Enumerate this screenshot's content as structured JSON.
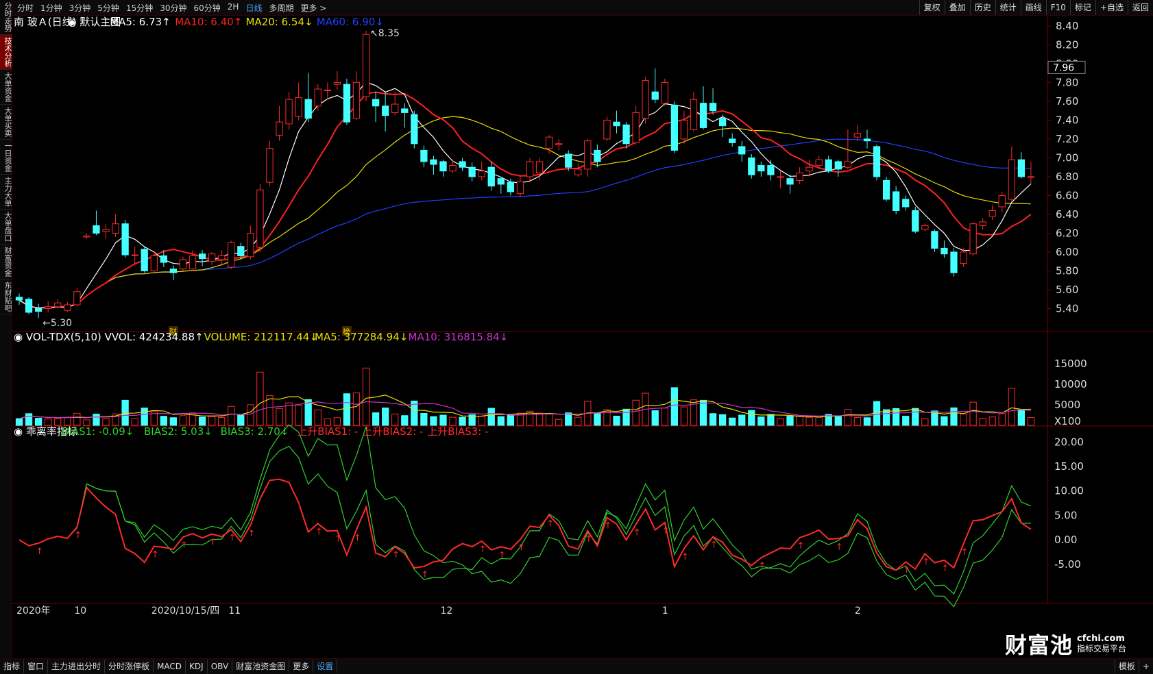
{
  "periods": [
    "分时",
    "1分钟",
    "3分钟",
    "5分钟",
    "15分钟",
    "30分钟",
    "60分钟",
    "2H",
    "日线",
    "多周期",
    "更多 >"
  ],
  "active_period": "日线",
  "tools": [
    "复权",
    "叠加",
    "历史",
    "统计",
    "画线",
    "F10",
    "标记",
    "+自选",
    "返回"
  ],
  "sidebar": [
    "分时走势",
    "技术分析",
    "大单资金",
    "大单买卖",
    "一日资金",
    "主力大单",
    "大单盘口",
    "财富资金",
    "东财贴吧"
  ],
  "sidebar_active": 1,
  "bottom_tabs": [
    "指标",
    "窗口",
    "主力进出分时",
    "分时涨停板",
    "MACD",
    "KDJ",
    "OBV",
    "财富池资金图",
    "更多",
    "设置"
  ],
  "bottom_right": [
    "模板",
    "+"
  ],
  "logo": {
    "name": "财富池",
    "site": "cfchi.com",
    "tag": "指标交易平台"
  },
  "colors": {
    "up": "#ff2a2a",
    "down": "#44ffff",
    "ma5": "#ffffff",
    "ma10": "#ff2020",
    "ma20": "#e8e000",
    "ma60": "#2040ff",
    "bias1": "#ff2a2a",
    "bias2": "#30d030",
    "bias3": "#30d030",
    "vma5": "#e8e000",
    "vma10": "#cc33cc"
  },
  "chart_data": {
    "type": "candlestick",
    "stock": "南 玻Ａ(日线)",
    "main_chart_label": "默认主图",
    "ma_labels": [
      {
        "text": "MA5: 6.73↑",
        "color": "#ffffff"
      },
      {
        "text": "MA10: 6.40↑",
        "color": "#ff2020"
      },
      {
        "text": "MA20: 6.54↓",
        "color": "#e8e000"
      },
      {
        "text": "MA60: 6.90↓",
        "color": "#2040ff"
      }
    ],
    "price_axis": [
      "8.40",
      "8.20",
      "8.00",
      "7.80",
      "7.60",
      "7.40",
      "7.20",
      "7.00",
      "6.80",
      "6.60",
      "6.40",
      "6.20",
      "6.00",
      "5.80",
      "5.60",
      "5.40"
    ],
    "price_marker": "7.96",
    "ylim": [
      5.2,
      8.45
    ],
    "high_label": "8.35",
    "low_label": "5.30",
    "candles": [
      [
        5.52,
        5.49,
        5.56,
        5.44
      ],
      [
        5.5,
        5.36,
        5.52,
        5.34
      ],
      [
        5.4,
        5.37,
        5.45,
        5.3
      ],
      [
        5.4,
        5.42,
        5.48,
        5.36
      ],
      [
        5.42,
        5.46,
        5.5,
        5.4
      ],
      [
        5.38,
        5.44,
        5.47,
        5.36
      ],
      [
        5.44,
        5.58,
        5.62,
        5.42
      ],
      [
        6.16,
        6.17,
        6.2,
        6.14
      ],
      [
        6.28,
        6.2,
        6.44,
        6.18
      ],
      [
        6.22,
        6.24,
        6.3,
        6.14
      ],
      [
        6.2,
        6.3,
        6.4,
        6.16
      ],
      [
        6.3,
        5.97,
        6.34,
        5.94
      ],
      [
        5.97,
        5.97,
        6.06,
        5.87
      ],
      [
        6.03,
        5.8,
        6.06,
        5.78
      ],
      [
        5.8,
        5.96,
        6.0,
        5.77
      ],
      [
        5.96,
        5.89,
        6.02,
        5.84
      ],
      [
        5.82,
        5.78,
        5.86,
        5.7
      ],
      [
        5.82,
        5.92,
        5.95,
        5.8
      ],
      [
        5.82,
        5.96,
        6.02,
        5.8
      ],
      [
        5.98,
        5.93,
        6.02,
        5.85
      ],
      [
        5.9,
        5.98,
        6.0,
        5.86
      ],
      [
        5.92,
        5.96,
        6.02,
        5.85
      ],
      [
        5.84,
        6.1,
        6.12,
        5.82
      ],
      [
        6.06,
        5.96,
        6.1,
        5.92
      ],
      [
        5.95,
        6.2,
        6.28,
        5.92
      ],
      [
        6.05,
        6.66,
        6.72,
        6.0
      ],
      [
        6.74,
        7.1,
        7.18,
        6.7
      ],
      [
        7.24,
        7.38,
        7.55,
        7.18
      ],
      [
        7.36,
        7.62,
        7.7,
        7.3
      ],
      [
        7.44,
        7.64,
        7.8,
        7.4
      ],
      [
        7.62,
        7.42,
        7.9,
        7.38
      ],
      [
        7.55,
        7.73,
        7.78,
        7.5
      ],
      [
        7.72,
        7.72,
        7.8,
        7.62
      ],
      [
        7.78,
        7.8,
        7.92,
        7.72
      ],
      [
        7.78,
        7.38,
        7.84,
        7.35
      ],
      [
        7.42,
        7.8,
        7.92,
        7.4
      ],
      [
        7.65,
        8.31,
        8.35,
        7.6
      ],
      [
        7.62,
        7.55,
        7.7,
        7.38
      ],
      [
        7.55,
        7.45,
        7.7,
        7.28
      ],
      [
        7.48,
        7.57,
        7.7,
        7.45
      ],
      [
        7.52,
        7.48,
        7.58,
        7.32
      ],
      [
        7.46,
        7.15,
        7.5,
        7.1
      ],
      [
        7.08,
        6.96,
        7.13,
        6.9
      ],
      [
        6.98,
        6.93,
        7.02,
        6.82
      ],
      [
        6.96,
        6.86,
        6.98,
        6.8
      ],
      [
        6.86,
        6.92,
        6.98,
        6.84
      ],
      [
        6.96,
        6.9,
        7.0,
        6.86
      ],
      [
        6.9,
        6.8,
        6.95,
        6.75
      ],
      [
        6.8,
        6.86,
        6.96,
        6.76
      ],
      [
        6.9,
        6.7,
        6.96,
        6.65
      ],
      [
        6.78,
        6.72,
        6.8,
        6.62
      ],
      [
        6.74,
        6.64,
        6.78,
        6.6
      ],
      [
        6.62,
        6.75,
        6.8,
        6.58
      ],
      [
        6.8,
        6.96,
        7.0,
        6.74
      ],
      [
        6.84,
        6.96,
        7.0,
        6.76
      ],
      [
        7.1,
        7.22,
        7.24,
        7.04
      ],
      [
        7.14,
        7.15,
        7.2,
        7.08
      ],
      [
        7.04,
        6.9,
        7.08,
        6.86
      ],
      [
        6.82,
        6.88,
        6.94,
        6.8
      ],
      [
        6.88,
        7.18,
        7.2,
        6.8
      ],
      [
        7.08,
        6.96,
        7.14,
        6.9
      ],
      [
        7.2,
        7.4,
        7.44,
        7.18
      ],
      [
        7.38,
        7.34,
        7.5,
        7.26
      ],
      [
        7.35,
        7.15,
        7.38,
        7.1
      ],
      [
        7.16,
        7.48,
        7.55,
        7.14
      ],
      [
        7.42,
        7.82,
        7.86,
        7.36
      ],
      [
        7.7,
        7.62,
        7.95,
        7.58
      ],
      [
        7.58,
        7.8,
        7.84,
        7.55
      ],
      [
        7.56,
        7.08,
        7.6,
        7.05
      ],
      [
        7.2,
        7.4,
        7.5,
        7.15
      ],
      [
        7.3,
        7.62,
        7.7,
        7.28
      ],
      [
        7.58,
        7.32,
        7.76,
        7.3
      ],
      [
        7.58,
        7.5,
        7.74,
        7.46
      ],
      [
        7.42,
        7.34,
        7.46,
        7.22
      ],
      [
        7.2,
        7.16,
        7.26,
        7.12
      ],
      [
        7.12,
        7.04,
        7.18,
        6.96
      ],
      [
        7.0,
        6.82,
        7.04,
        6.78
      ],
      [
        6.92,
        6.86,
        6.96,
        6.8
      ],
      [
        6.92,
        6.82,
        6.98,
        6.76
      ],
      [
        6.8,
        6.8,
        6.86,
        6.68
      ],
      [
        6.78,
        6.72,
        6.82,
        6.62
      ],
      [
        6.76,
        6.84,
        6.9,
        6.72
      ],
      [
        6.86,
        6.9,
        6.98,
        6.8
      ],
      [
        6.92,
        6.98,
        7.02,
        6.88
      ],
      [
        6.98,
        6.86,
        7.02,
        6.84
      ],
      [
        6.96,
        6.88,
        6.98,
        6.8
      ],
      [
        6.9,
        6.96,
        7.3,
        6.88
      ],
      [
        7.22,
        7.26,
        7.35,
        7.18
      ],
      [
        7.2,
        7.18,
        7.3,
        7.1
      ],
      [
        7.12,
        6.8,
        7.14,
        6.76
      ],
      [
        6.76,
        6.56,
        6.8,
        6.54
      ],
      [
        6.64,
        6.44,
        6.7,
        6.4
      ],
      [
        6.56,
        6.48,
        6.6,
        6.44
      ],
      [
        6.44,
        6.22,
        6.48,
        6.2
      ],
      [
        6.24,
        6.28,
        6.3,
        6.22
      ],
      [
        6.22,
        6.04,
        6.24,
        6.0
      ],
      [
        6.04,
        5.98,
        6.12,
        5.94
      ],
      [
        6.0,
        5.78,
        6.04,
        5.74
      ],
      [
        5.88,
        6.0,
        6.04,
        5.84
      ],
      [
        5.98,
        6.3,
        6.32,
        5.96
      ],
      [
        6.28,
        6.32,
        6.36,
        6.24
      ],
      [
        6.38,
        6.44,
        6.5,
        6.34
      ],
      [
        6.48,
        6.6,
        6.64,
        6.42
      ],
      [
        6.56,
        6.98,
        7.12,
        6.54
      ],
      [
        6.98,
        6.8,
        7.06,
        6.78
      ],
      [
        6.8,
        6.8,
        6.96,
        6.72
      ]
    ],
    "volume_label": "VOL-TDX(5,10) VVOL: 424234.88↑",
    "volume_labels": [
      {
        "text": "VOLUME: 212117.44↓",
        "color": "#e8e000"
      },
      {
        "text": "MA5: 377284.94↓",
        "color": "#e8e000"
      },
      {
        "text": "MA10: 316815.84↓",
        "color": "#cc33cc"
      }
    ],
    "volume_axis": [
      "15000",
      "10000",
      "5000",
      "X100"
    ],
    "volume_max": 17500,
    "bias_name": "乖离率指标",
    "bias_labels": [
      {
        "text": "BIAS1: -0.09↓",
        "color": "#30d030"
      },
      {
        "text": "BIAS2: 5.03↓",
        "color": "#30d030"
      },
      {
        "text": "BIAS3: 2.70↓",
        "color": "#30d030"
      },
      {
        "text": "上升BIAS1: -",
        "color": "#ff2a2a"
      },
      {
        "text": "上升BIAS2: -",
        "color": "#ff2a2a"
      },
      {
        "text": "上升BIAS3: -",
        "color": "#ff2a2a"
      }
    ],
    "bias_axis": [
      "20.00",
      "15.00",
      "10.00",
      "5.00",
      "0.00",
      "-5.00"
    ],
    "bias_ylim": [
      -13,
      22
    ],
    "x_labels": [
      {
        "text": "2020年",
        "i": 0
      },
      {
        "text": "10",
        "i": 6
      },
      {
        "text": "2020/10/15/四",
        "i": 14
      },
      {
        "text": "11",
        "i": 22
      },
      {
        "text": "12",
        "i": 44
      },
      {
        "text": "1",
        "i": 67
      },
      {
        "text": "2",
        "i": 87
      }
    ],
    "flags": [
      {
        "text": "财",
        "i": 16
      },
      {
        "text": "榜",
        "i": 34
      }
    ]
  }
}
